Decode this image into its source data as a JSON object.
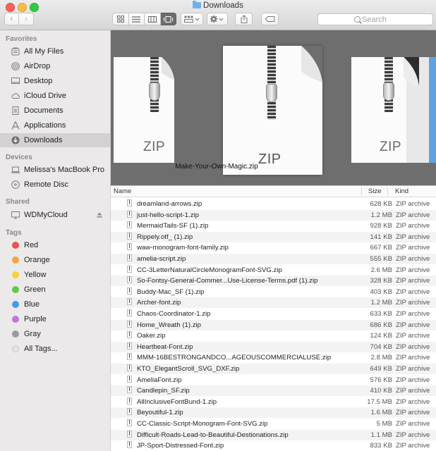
{
  "window": {
    "title": "Downloads",
    "search_placeholder": "Search"
  },
  "toolbar": {
    "back_glyph": "‹",
    "forward_glyph": "›",
    "view_modes": [
      "icon-view",
      "list-view",
      "column-view",
      "cover-flow-view"
    ],
    "active_view": "cover-flow-view"
  },
  "sidebar": {
    "favorites_header": "Favorites",
    "favorites": [
      {
        "label": "All My Files",
        "icon": "all-files-icon"
      },
      {
        "label": "AirDrop",
        "icon": "airdrop-icon"
      },
      {
        "label": "Desktop",
        "icon": "desktop-icon"
      },
      {
        "label": "iCloud Drive",
        "icon": "cloud-icon"
      },
      {
        "label": "Documents",
        "icon": "documents-icon"
      },
      {
        "label": "Applications",
        "icon": "applications-icon"
      },
      {
        "label": "Downloads",
        "icon": "downloads-icon",
        "selected": true
      }
    ],
    "devices_header": "Devices",
    "devices": [
      {
        "label": "Melissa's MacBook Pro",
        "icon": "laptop-icon"
      },
      {
        "label": "Remote Disc",
        "icon": "disc-icon"
      }
    ],
    "shared_header": "Shared",
    "shared": [
      {
        "label": "WDMyCloud",
        "icon": "monitor-icon",
        "eject_icon": "eject-icon"
      }
    ],
    "tags_header": "Tags",
    "tags": [
      {
        "label": "Red",
        "color": "#f0524f"
      },
      {
        "label": "Orange",
        "color": "#f7a33d"
      },
      {
        "label": "Yellow",
        "color": "#f6d23b"
      },
      {
        "label": "Green",
        "color": "#5fc94d"
      },
      {
        "label": "Blue",
        "color": "#3f9bf1"
      },
      {
        "label": "Purple",
        "color": "#bf77d8"
      },
      {
        "label": "Gray",
        "color": "#9b9b9b"
      },
      {
        "label": "All Tags...",
        "color": "#e3e3e3"
      }
    ]
  },
  "coverflow": {
    "caption": "Make-Your-Own-Magic.zip",
    "left_label": "ZIP",
    "center_label": "ZIP",
    "right_label": "ZIP",
    "background": "#6e6e6e"
  },
  "list": {
    "columns": {
      "name": "Name",
      "size": "Size",
      "kind": "Kind"
    },
    "rows": [
      {
        "name": "dreamland-arrows.zip",
        "size": "628 KB",
        "kind": "ZIP archive"
      },
      {
        "name": "just-hello-script-1.zip",
        "size": "1.2 MB",
        "kind": "ZIP archive"
      },
      {
        "name": "MermaidTails-SF (1).zip",
        "size": "928 KB",
        "kind": "ZIP archive"
      },
      {
        "name": "Rippely.otf_ (1).zip",
        "size": "141 KB",
        "kind": "ZIP archive"
      },
      {
        "name": "waw-monogram-font-family.zip",
        "size": "667 KB",
        "kind": "ZIP archive"
      },
      {
        "name": "amelia-script.zip",
        "size": "555 KB",
        "kind": "ZIP archive"
      },
      {
        "name": "CC-3LetterNaturalCircleMonogramFont-SVG.zip",
        "size": "2.6 MB",
        "kind": "ZIP archive"
      },
      {
        "name": "So-Fontsy-General-Commer...Use-License-Terms.pdf (1).zip",
        "size": "328 KB",
        "kind": "ZIP archive"
      },
      {
        "name": "Buddy-Mac_SF (1).zip",
        "size": "403 KB",
        "kind": "ZIP archive"
      },
      {
        "name": "Archer-font.zip",
        "size": "1.2 MB",
        "kind": "ZIP archive"
      },
      {
        "name": "Chaos-Coordinator-1.zip",
        "size": "633 KB",
        "kind": "ZIP archive"
      },
      {
        "name": "Home_Wreath (1).zip",
        "size": "686 KB",
        "kind": "ZIP archive"
      },
      {
        "name": "Oaker.zip",
        "size": "124 KB",
        "kind": "ZIP archive"
      },
      {
        "name": "Heartbeat-Font.zip",
        "size": "704 KB",
        "kind": "ZIP archive"
      },
      {
        "name": "MMM-16BESTRONGANDCO...AGEOUSCOMMERCIALUSE.zip",
        "size": "2.8 MB",
        "kind": "ZIP archive"
      },
      {
        "name": "KTO_ElegantScroll_SVG_DXF.zip",
        "size": "649 KB",
        "kind": "ZIP archive"
      },
      {
        "name": "AmeliaFont.zip",
        "size": "576 KB",
        "kind": "ZIP archive"
      },
      {
        "name": "Candlepin_SF.zip",
        "size": "410 KB",
        "kind": "ZIP archive"
      },
      {
        "name": "AllInclusiveFontBund-1.zip",
        "size": "17.5 MB",
        "kind": "ZIP archive"
      },
      {
        "name": "Beyoutiful-1.zip",
        "size": "1.6 MB",
        "kind": "ZIP archive"
      },
      {
        "name": "CC-Classic-Script-Monogram-Font-SVG.zip",
        "size": "5 MB",
        "kind": "ZIP archive"
      },
      {
        "name": "Difficult-Roads-Lead-to-Beautiful-Destionations.zip",
        "size": "1.1 MB",
        "kind": "ZIP archive"
      },
      {
        "name": "JP-Sport-Distressed-Font.zip",
        "size": "833 KB",
        "kind": "ZIP archive"
      }
    ]
  }
}
